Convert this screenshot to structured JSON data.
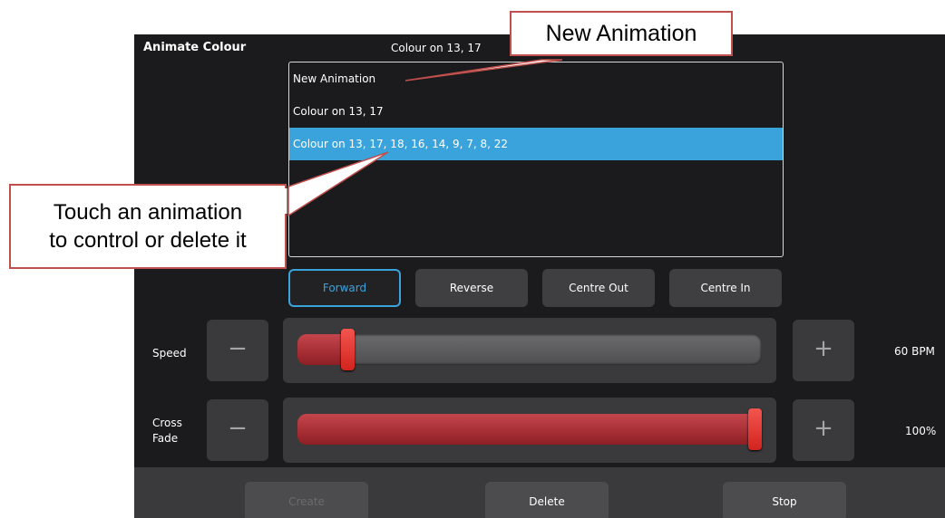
{
  "panel": {
    "title": "Animate Colour",
    "header_selection": "Colour on 13, 17"
  },
  "animations": {
    "items": [
      {
        "label": "New Animation",
        "selected": false
      },
      {
        "label": "Colour on 13, 17",
        "selected": false
      },
      {
        "label": "Colour on 13, 17, 18, 16, 14, 9, 7, 8, 22",
        "selected": true
      }
    ]
  },
  "direction": {
    "buttons": [
      {
        "label": "Forward",
        "active": true
      },
      {
        "label": "Reverse",
        "active": false
      },
      {
        "label": "Centre Out",
        "active": false
      },
      {
        "label": "Centre In",
        "active": false
      }
    ]
  },
  "speed": {
    "label": "Speed",
    "minus": "−",
    "plus": "+",
    "value_text": "60 BPM",
    "level": 0.11
  },
  "crossfade": {
    "label_line1": "Cross",
    "label_line2": "Fade",
    "minus": "−",
    "plus": "+",
    "value_text": "100%",
    "level": 1.0
  },
  "actions": {
    "create": "Create",
    "delete": "Delete",
    "stop": "Stop"
  },
  "callouts": {
    "new_animation": "New Animation",
    "touch_line1": "Touch an animation",
    "touch_line2": "to control or delete it"
  },
  "colors": {
    "accent": "#3ba3dc",
    "callout_border": "#c0504d",
    "slider_fill": "#b33a40"
  }
}
